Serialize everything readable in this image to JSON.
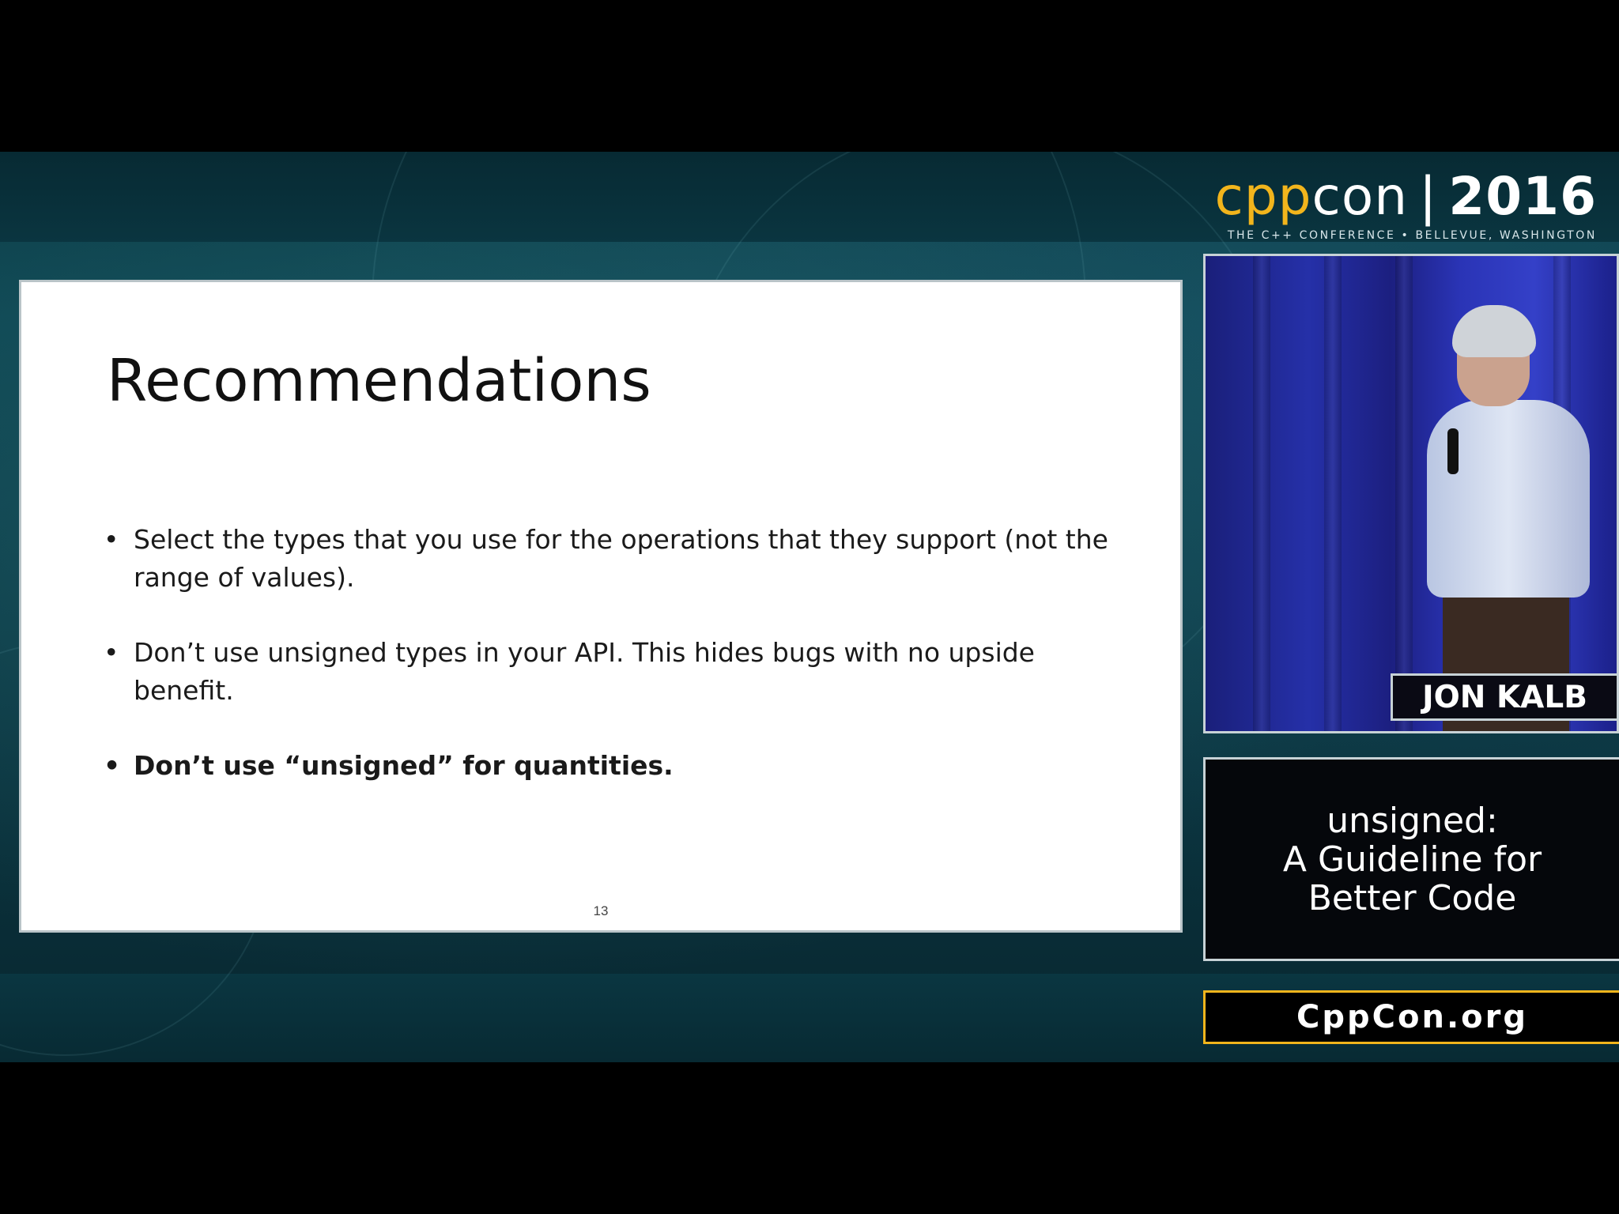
{
  "brand": {
    "logo_cpp": "cpp",
    "logo_con": "con",
    "logo_sep": "|",
    "logo_year": "2016",
    "tagline": "THE C++ CONFERENCE • BELLEVUE, WASHINGTON",
    "accent_color": "#f2b51c"
  },
  "slide": {
    "title": "Recommendations",
    "bullet_glyph": "•",
    "bullets": [
      "Select the types that you use for the operations that they support (not the range of values).",
      "Don’t use unsigned types in your API. This hides bugs with no upside benefit.",
      "Don’t use “unsigned” for quantities."
    ],
    "page_number": "13"
  },
  "speaker": {
    "name": "JON KALB"
  },
  "talk": {
    "title_lines": [
      "unsigned:",
      "A Guideline for",
      "Better Code"
    ]
  },
  "site": {
    "url": "CppCon.org"
  }
}
